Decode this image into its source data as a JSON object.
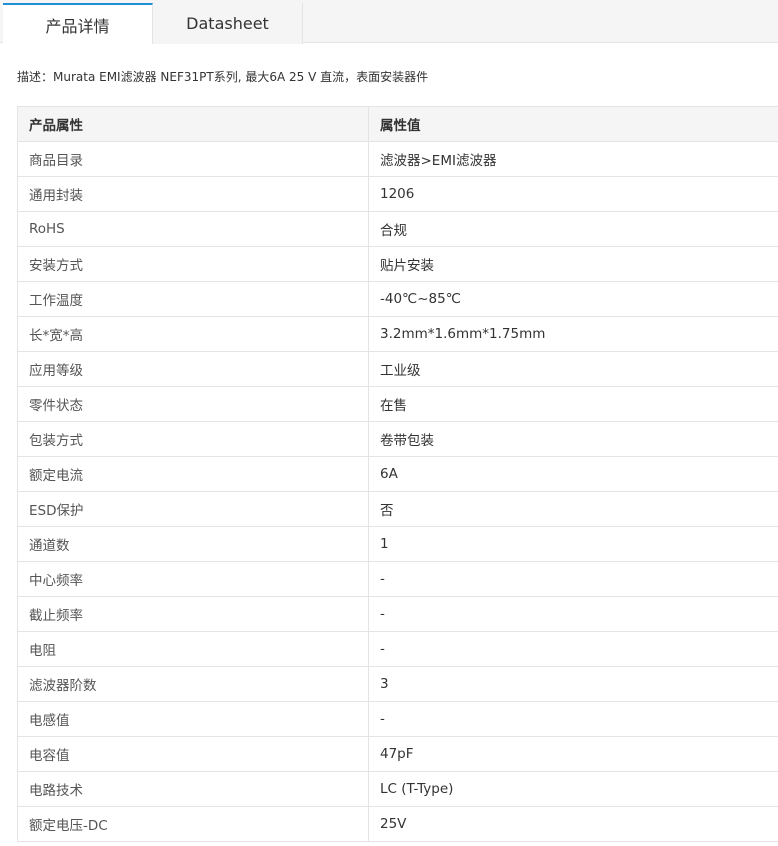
{
  "tabs": [
    {
      "label": "产品详情",
      "active": true
    },
    {
      "label": "Datasheet",
      "active": false
    }
  ],
  "description": "描述：Murata EMI滤波器 NEF31PT系列, 最大6A 25 V 直流，表面安装器件",
  "table": {
    "headers": [
      "产品属性",
      "属性值"
    ],
    "rows": [
      {
        "name": "商品目录",
        "value": "滤波器>EMI滤波器"
      },
      {
        "name": "通用封装",
        "value": "1206"
      },
      {
        "name": "RoHS",
        "value": "合规"
      },
      {
        "name": "安装方式",
        "value": "贴片安装"
      },
      {
        "name": "工作温度",
        "value": "-40℃~85℃"
      },
      {
        "name": "长*宽*高",
        "value": "3.2mm*1.6mm*1.75mm"
      },
      {
        "name": "应用等级",
        "value": "工业级"
      },
      {
        "name": "零件状态",
        "value": "在售"
      },
      {
        "name": "包装方式",
        "value": "卷带包装"
      },
      {
        "name": "额定电流",
        "value": "6A"
      },
      {
        "name": "ESD保护",
        "value": "否"
      },
      {
        "name": "通道数",
        "value": "1"
      },
      {
        "name": "中心频率",
        "value": "-"
      },
      {
        "name": "截止频率",
        "value": "-"
      },
      {
        "name": "电阻",
        "value": "-"
      },
      {
        "name": "滤波器阶数",
        "value": "3"
      },
      {
        "name": "电感值",
        "value": "-"
      },
      {
        "name": "电容值",
        "value": "47pF"
      },
      {
        "name": "电路技术",
        "value": "LC (T-Type)"
      },
      {
        "name": "额定电压-DC",
        "value": "25V"
      }
    ]
  },
  "colors": {
    "tab_accent": "#1f8fd6",
    "header_bg": "#f5f5f5",
    "border": "#e4e4e4"
  }
}
